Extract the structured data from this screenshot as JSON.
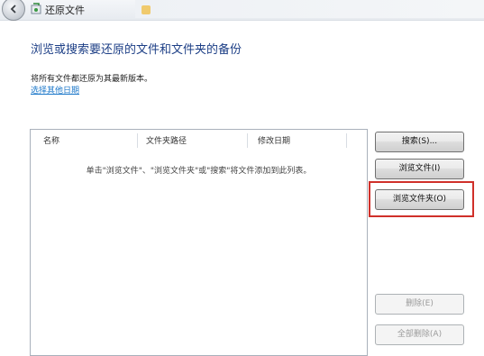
{
  "window": {
    "title": "还原文件"
  },
  "main": {
    "heading": "浏览或搜索要还原的文件和文件夹的备份",
    "info_text": "将所有文件都还原为其最新版本。",
    "choose_date_link": "选择其他日期"
  },
  "file_list": {
    "columns": [
      "名称",
      "文件夹路径",
      "修改日期"
    ],
    "empty_message": "单击\"浏览文件\"、\"浏览文件夹\"或\"搜索\"将文件添加到此列表。"
  },
  "buttons": {
    "search": "搜索(S)...",
    "browse_files": "浏览文件(I)",
    "browse_folders": "浏览文件夹(O)",
    "remove": "删除(E)",
    "remove_all": "全部删除(A)"
  },
  "colors": {
    "heading": "#1d3f86",
    "link": "#1b77c9",
    "highlight_border": "#d0302a"
  }
}
